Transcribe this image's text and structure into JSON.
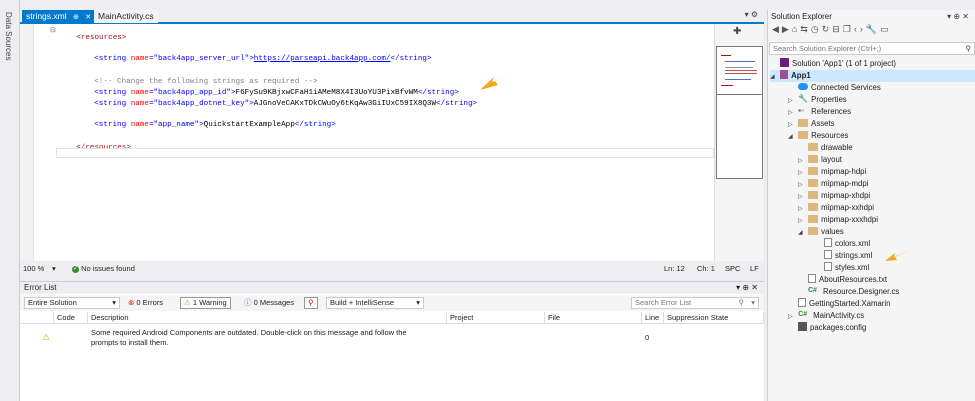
{
  "left_rail": {
    "label": "Data Sources"
  },
  "tabs": [
    {
      "label": "strings.xml",
      "active": true
    },
    {
      "label": "MainActivity.cs",
      "active": false
    }
  ],
  "editor": {
    "lines": {
      "l1": {
        "open": "<resources>"
      },
      "l2": {
        "tag_open": "<string",
        "attr": "name",
        "eq": "=",
        "val": "\"back4app_server_url\"",
        "close": ">",
        "text": "https://parseapi.back4app.com/",
        "end": "</string>"
      },
      "l3": {
        "comment": "<!-- Change the following strings as required -->"
      },
      "l4": {
        "tag_open": "<string",
        "attr": "name",
        "eq": "=",
        "val": "\"back4app_app_id\"",
        "close": ">",
        "text": "F6FySu9KBjxwCFaH1iAMeM8X4I3UoYU3PixBfvWM",
        "end": "</string>"
      },
      "l5": {
        "tag_open": "<string",
        "attr": "name",
        "eq": "=",
        "val": "\"back4app_dotnet_key\"",
        "close": ">",
        "text": "AJGnoVeCAKxTDkCWuOy6tKqAw3GiIUxC59IX8Q3W",
        "end": "</string>"
      },
      "l6": {
        "tag_open": "<string",
        "attr": "name",
        "eq": "=",
        "val": "\"app_name\"",
        "close": ">",
        "text": "QuickstartExampleApp",
        "end": "</string>"
      },
      "l7": {
        "close_tag": "</resources>"
      }
    }
  },
  "statusbar": {
    "zoom": "100 %",
    "issues": "No issues found",
    "ln": "Ln: 12",
    "ch": "Ch: 1",
    "spc": "SPC",
    "lf": "LF"
  },
  "error_list": {
    "title": "Error List",
    "scope": "Entire Solution",
    "errors": "0 Errors",
    "warnings": "1 Warning",
    "messages": "0 Messages",
    "build_filter": "Build + IntelliSense",
    "search_placeholder": "Search Error List",
    "columns": [
      "Code",
      "Description",
      "Project",
      "File",
      "Line",
      "Suppression State"
    ],
    "rows": [
      {
        "code": "",
        "description_1": "Some required Android Components are outdated. Double-click on this message and follow the",
        "description_2": "prompts to install them.",
        "project": "",
        "file": "",
        "line": "0",
        "suppression": ""
      }
    ]
  },
  "solution_explorer": {
    "title": "Solution Explorer",
    "search_placeholder": "Search Solution Explorer (Ctrl+;)",
    "tree": [
      {
        "label": "Solution 'App1' (1 of 1 project)",
        "icon": "solution-icon",
        "depth": 0
      },
      {
        "label": "App1",
        "icon": "project-icon",
        "depth": 1,
        "expanded": true,
        "bold": true
      },
      {
        "label": "Connected Services",
        "icon": "connected-services-icon",
        "depth": 2
      },
      {
        "label": "Properties",
        "icon": "wrench-icon",
        "depth": 2,
        "expander": true
      },
      {
        "label": "References",
        "icon": "references-icon",
        "depth": 2,
        "expander": true
      },
      {
        "label": "Assets",
        "icon": "folder-icon",
        "depth": 2,
        "expander": true
      },
      {
        "label": "Resources",
        "icon": "folder-icon",
        "depth": 2,
        "expanded": true
      },
      {
        "label": "drawable",
        "icon": "folder-icon",
        "depth": 3
      },
      {
        "label": "layout",
        "icon": "folder-icon",
        "depth": 3,
        "expander": true
      },
      {
        "label": "mipmap-hdpi",
        "icon": "folder-icon",
        "depth": 3,
        "expander": true
      },
      {
        "label": "mipmap-mdpi",
        "icon": "folder-icon",
        "depth": 3,
        "expander": true
      },
      {
        "label": "mipmap-xhdpi",
        "icon": "folder-icon",
        "depth": 3,
        "expander": true
      },
      {
        "label": "mipmap-xxhdpi",
        "icon": "folder-icon",
        "depth": 3,
        "expander": true
      },
      {
        "label": "mipmap-xxxhdpi",
        "icon": "folder-icon",
        "depth": 3,
        "expander": true
      },
      {
        "label": "values",
        "icon": "folder-icon",
        "depth": 3,
        "expanded": true
      },
      {
        "label": "colors.xml",
        "icon": "file-icon",
        "depth": 4
      },
      {
        "label": "strings.xml",
        "icon": "file-icon",
        "depth": 4
      },
      {
        "label": "styles.xml",
        "icon": "file-icon",
        "depth": 4
      },
      {
        "label": "AboutResources.txt",
        "icon": "file-icon",
        "depth": 3
      },
      {
        "label": "Resource.Designer.cs",
        "icon": "csharp-icon",
        "depth": 3
      },
      {
        "label": "GettingStarted.Xamarin",
        "icon": "file-icon",
        "depth": 2
      },
      {
        "label": "MainActivity.cs",
        "icon": "csharp-icon",
        "depth": 2,
        "expander": true
      },
      {
        "label": "packages.config",
        "icon": "package-icon",
        "depth": 2
      }
    ]
  },
  "colors": {
    "accent": "#007acc",
    "annotation_arrow": "#f5a623"
  }
}
